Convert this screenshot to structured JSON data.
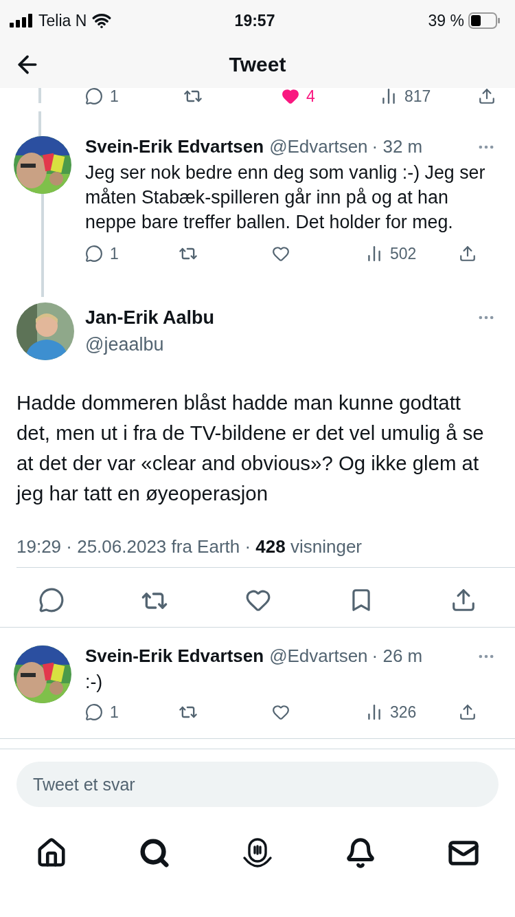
{
  "status_bar": {
    "carrier": "Telia N",
    "time": "19:57",
    "battery": "39 %"
  },
  "header": {
    "title": "Tweet"
  },
  "partial_actions": {
    "replies": "1",
    "likes": "4",
    "liked": true,
    "views": "817"
  },
  "replies_above": [
    {
      "author": "Svein-Erik Edvartsen",
      "handle": "@Edvartsen",
      "time": "· 32 m",
      "text": "Jeg ser nok bedre enn deg som vanlig :-) Jeg ser måten Stabæk-spilleren går inn på og at han neppe bare treffer ballen. Det holder for meg.",
      "replies": "1",
      "liked": false,
      "views": "502"
    }
  ],
  "main_tweet": {
    "author": "Jan-Erik Aalbu",
    "handle": "@jeaalbu",
    "text": "Hadde dommeren blåst hadde man kunne godtatt det, men ut i fra de TV-bildene er det vel umulig å se at det der var «clear and obvious»? Og ikke glem at jeg har tatt en øyeoperasjon",
    "meta": "19:29 · 25.06.2023 fra Earth · **428** visninger",
    "liked": false,
    "bookmarked": false
  },
  "replies_below": [
    {
      "author": "Svein-Erik Edvartsen",
      "handle": "@Edvartsen",
      "time": "· 26 m",
      "text": ":-)",
      "replies": "1",
      "liked": false,
      "views": "326"
    }
  ],
  "reply_field": {
    "placeholder": "Tweet et svar"
  }
}
